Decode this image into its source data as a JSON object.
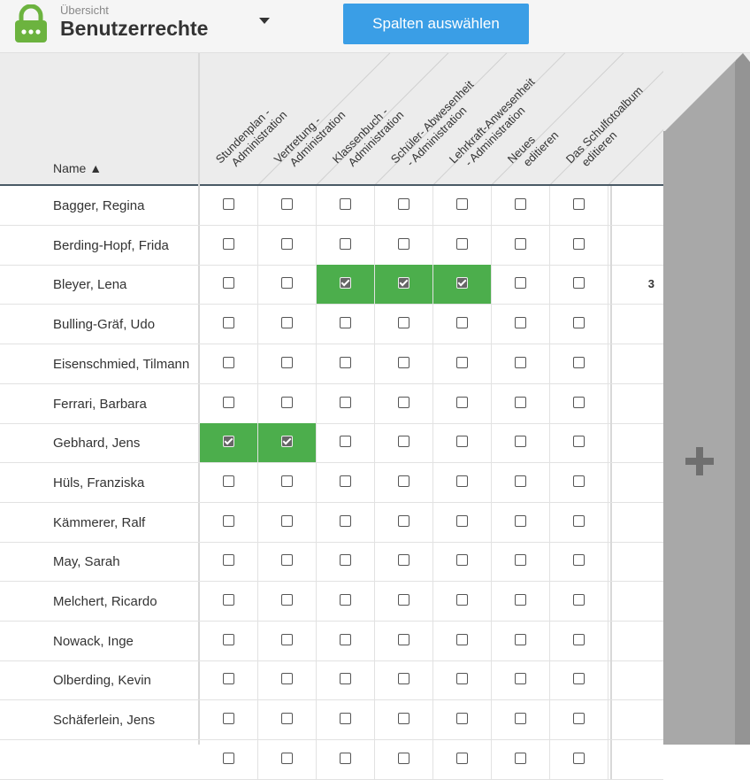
{
  "header": {
    "subtitle": "Übersicht",
    "title": "Benutzerrechte",
    "select_columns_label": "Spalten auswählen"
  },
  "colors": {
    "accent": "#3a9ee6",
    "checked": "#4cae4c",
    "lock": "#6cb33f"
  },
  "table": {
    "name_header": "Name ▲",
    "columns": [
      [
        "Stundenplan -",
        "Administration"
      ],
      [
        "Vertretung -",
        "Administration"
      ],
      [
        "Klassenbuch -",
        "Administration"
      ],
      [
        "Schüler- Abwesenheit",
        "- Administration"
      ],
      [
        "Lehrkraft-Anwesenheit",
        "- Administration"
      ],
      [
        "Neues",
        "editieren"
      ],
      [
        "Das Schulfotoalbum",
        "editieren"
      ]
    ],
    "rows": [
      {
        "name": "Bagger, Regina",
        "checks": [
          false,
          false,
          false,
          false,
          false,
          false,
          false
        ],
        "count": ""
      },
      {
        "name": "Berding-Hopf, Frida",
        "checks": [
          false,
          false,
          false,
          false,
          false,
          false,
          false
        ],
        "count": ""
      },
      {
        "name": "Bleyer, Lena",
        "checks": [
          false,
          false,
          true,
          true,
          true,
          false,
          false
        ],
        "count": "3"
      },
      {
        "name": "Bulling-Gräf, Udo",
        "checks": [
          false,
          false,
          false,
          false,
          false,
          false,
          false
        ],
        "count": ""
      },
      {
        "name": "Eisenschmied, Tilmann",
        "checks": [
          false,
          false,
          false,
          false,
          false,
          false,
          false
        ],
        "count": ""
      },
      {
        "name": "Ferrari, Barbara",
        "checks": [
          false,
          false,
          false,
          false,
          false,
          false,
          false
        ],
        "count": ""
      },
      {
        "name": "Gebhard, Jens",
        "checks": [
          true,
          true,
          false,
          false,
          false,
          false,
          false
        ],
        "count": ""
      },
      {
        "name": "Hüls, Franziska",
        "checks": [
          false,
          false,
          false,
          false,
          false,
          false,
          false
        ],
        "count": ""
      },
      {
        "name": "Kämmerer, Ralf",
        "checks": [
          false,
          false,
          false,
          false,
          false,
          false,
          false
        ],
        "count": ""
      },
      {
        "name": "May, Sarah",
        "checks": [
          false,
          false,
          false,
          false,
          false,
          false,
          false
        ],
        "count": ""
      },
      {
        "name": "Melchert, Ricardo",
        "checks": [
          false,
          false,
          false,
          false,
          false,
          false,
          false
        ],
        "count": ""
      },
      {
        "name": "Nowack, Inge",
        "checks": [
          false,
          false,
          false,
          false,
          false,
          false,
          false
        ],
        "count": ""
      },
      {
        "name": "Olberding, Kevin",
        "checks": [
          false,
          false,
          false,
          false,
          false,
          false,
          false
        ],
        "count": ""
      },
      {
        "name": "Schäferlein, Jens",
        "checks": [
          false,
          false,
          false,
          false,
          false,
          false,
          false
        ],
        "count": ""
      },
      {
        "name": "",
        "checks": [
          false,
          false,
          false,
          false,
          false,
          false,
          false
        ],
        "count": ""
      }
    ]
  },
  "icons": {
    "lock": "lock-icon",
    "dropdown": "chevron-down-icon",
    "add_column": "plus-icon"
  }
}
